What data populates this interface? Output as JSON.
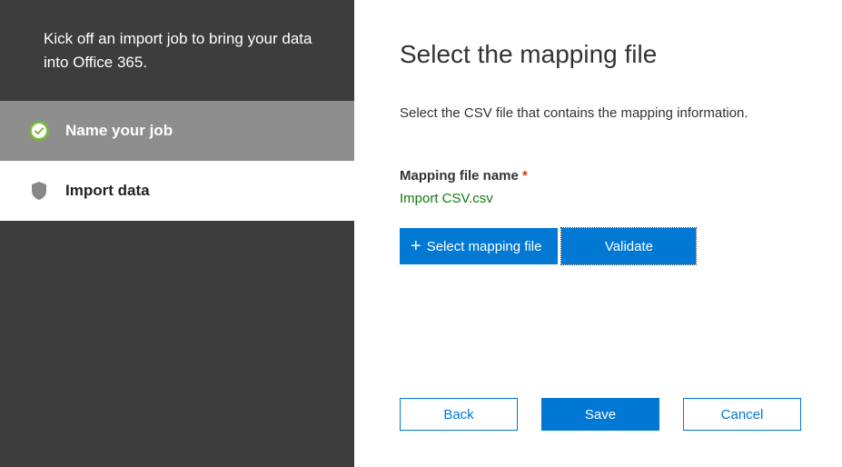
{
  "sidebar": {
    "header": "Kick off an import job to bring your data into Office 365.",
    "steps": [
      {
        "label": "Name your job"
      },
      {
        "label": "Import data"
      }
    ]
  },
  "main": {
    "title": "Select the mapping file",
    "description": "Select the CSV file that contains the mapping information.",
    "field_label": "Mapping file name",
    "required_mark": "*",
    "file_name": "Import CSV.csv",
    "select_file_label": "Select mapping file",
    "validate_label": "Validate"
  },
  "footer": {
    "back": "Back",
    "save": "Save",
    "cancel": "Cancel"
  }
}
